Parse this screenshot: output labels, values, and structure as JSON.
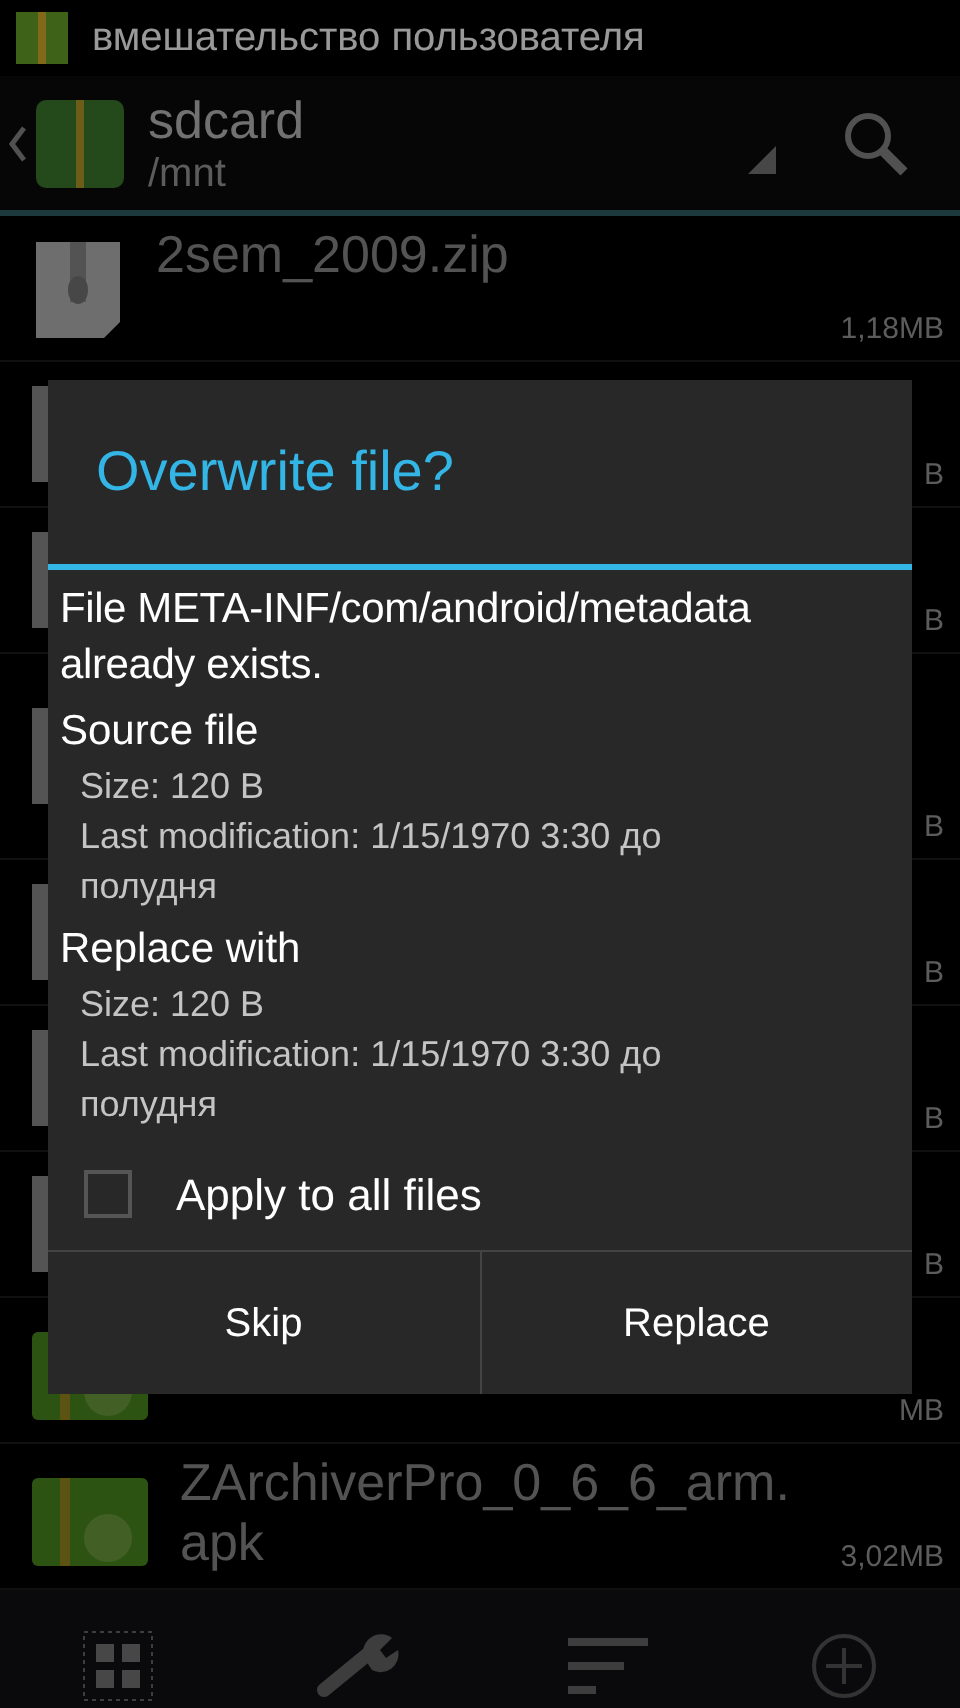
{
  "status_bar": {
    "notification": "вмешательство пользователя"
  },
  "action_bar": {
    "title": "sdcard",
    "path": "/mnt"
  },
  "files": [
    {
      "kind": "zip",
      "name": "2sem_2009.zip",
      "size": "1,18MB"
    },
    {
      "kind": "file",
      "size": "B"
    },
    {
      "kind": "file",
      "size": "B"
    },
    {
      "kind": "file",
      "tall": true,
      "size": "B"
    },
    {
      "kind": "file",
      "size": "B"
    },
    {
      "kind": "file",
      "size": "B"
    },
    {
      "kind": "file",
      "size": "B"
    },
    {
      "kind": "apk",
      "size": "MB"
    },
    {
      "kind": "apk",
      "name": "ZArchiverPro_0_6_6_arm.\napk",
      "size": "3,02MB"
    }
  ],
  "dialog": {
    "title": "Overwrite file?",
    "message": "File META-INF/com/android/metadata already exists.",
    "sections": [
      {
        "heading": "Source file",
        "size": "Size: 120 B",
        "modified": "Last modification: 1/15/1970 3:30 до полудня"
      },
      {
        "heading": "Replace with",
        "size": "Size: 120 B",
        "modified": "Last modification: 1/15/1970 3:30 до полудня"
      }
    ],
    "apply_all": {
      "label": "Apply to all files",
      "checked": false
    },
    "buttons": [
      "Skip",
      "Replace"
    ]
  }
}
